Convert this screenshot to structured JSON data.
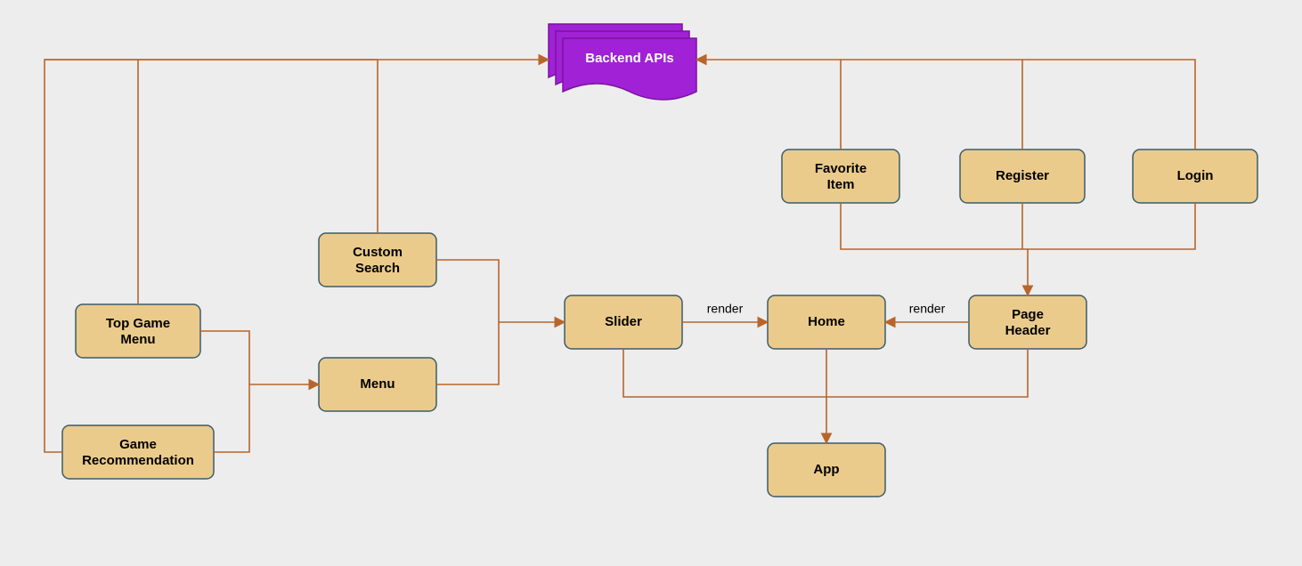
{
  "backend": {
    "label": "Backend  APIs"
  },
  "nodes": {
    "top_game_menu_l1": "Top Game",
    "top_game_menu_l2": "Menu",
    "game_reco_l1": "Game",
    "game_reco_l2": "Recommendation",
    "custom_search_l1": "Custom",
    "custom_search_l2": "Search",
    "menu": "Menu",
    "slider": "Slider",
    "home": "Home",
    "page_header_l1": "Page",
    "page_header_l2": "Header",
    "favorite_item_l1": "Favorite",
    "favorite_item_l2": "Item",
    "register": "Register",
    "login": "Login",
    "app": "App"
  },
  "edges": {
    "slider_home": "render",
    "header_home": "render"
  }
}
